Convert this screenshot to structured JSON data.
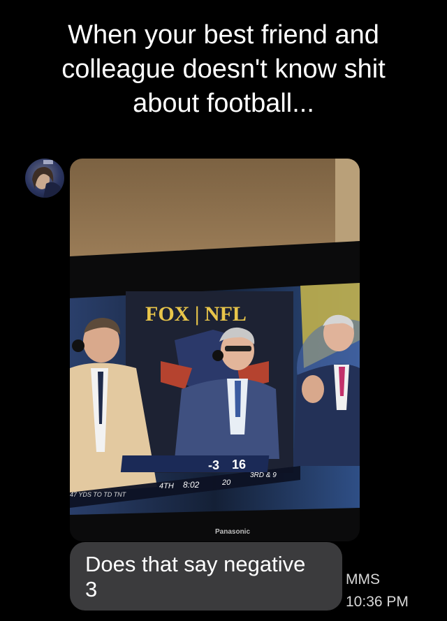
{
  "post": {
    "caption": "When your best friend and\ncolleague doesn't know shit\nabout football..."
  },
  "photo": {
    "network_logo_text": "FOX | NFL",
    "tv_brand": "Panasonic",
    "scoreboard": {
      "spread": "-3",
      "score": "16",
      "score_sub": "20",
      "quarter": "4TH",
      "clock": "8:02",
      "down_distance": "3RD & 9",
      "ticker": "47 YDS TO TD TNT"
    }
  },
  "message": {
    "text": "Does that say negative\n3",
    "type_label": "MMS",
    "time": "10:36 PM"
  },
  "colors": {
    "background": "#000000",
    "bubble": "#3b3b3d",
    "text": "#ffffff",
    "fox_yellow": "#e8c54a"
  }
}
